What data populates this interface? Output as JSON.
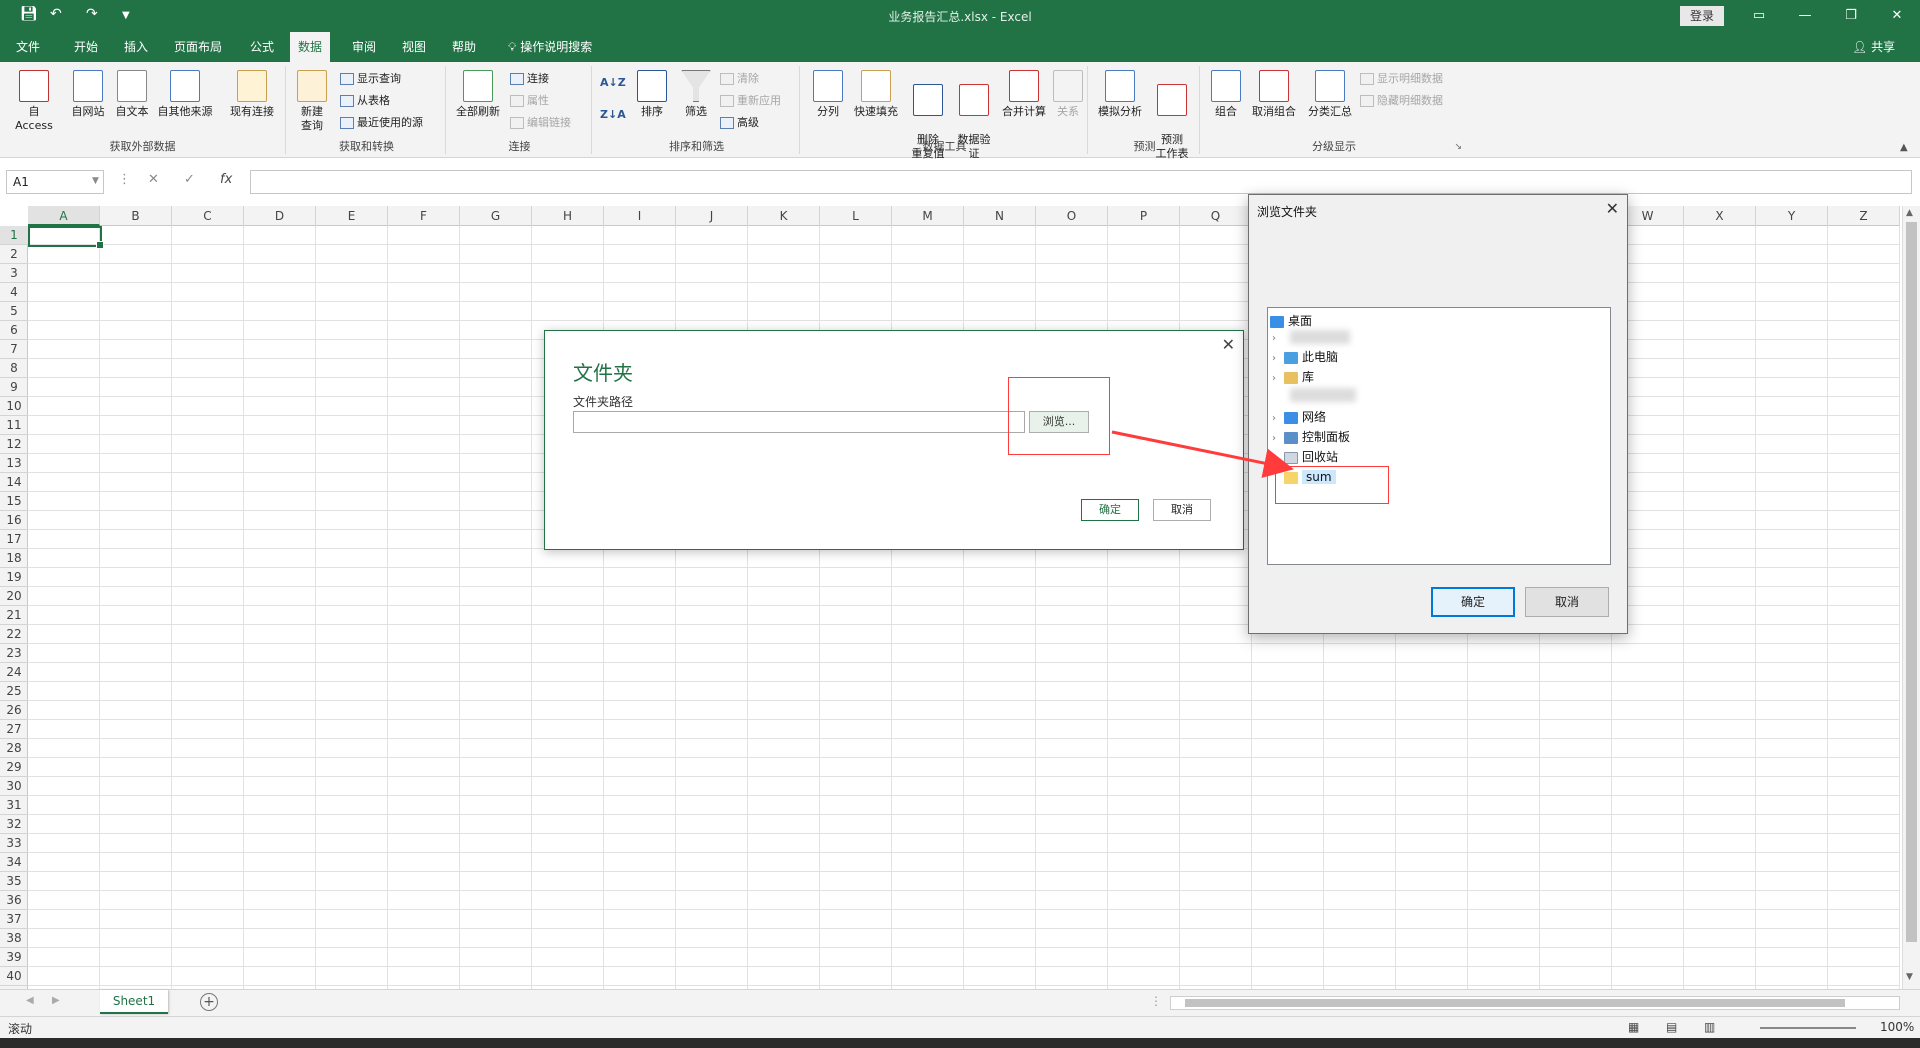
{
  "window": {
    "title": "业务报告汇总.xlsx  -  Excel",
    "login_label": "登录",
    "share_label": "共享"
  },
  "tabs": [
    "文件",
    "开始",
    "插入",
    "页面布局",
    "公式",
    "数据",
    "审阅",
    "视图",
    "帮助",
    "操作说明搜索"
  ],
  "active_tab": "数据",
  "ribbon": {
    "get_external": {
      "label": "获取外部数据",
      "buttons": [
        "自 Access",
        "自网站",
        "自文本",
        "自其他来源",
        "现有连接"
      ]
    },
    "get_transform": {
      "label": "获取和转换",
      "new_query_1": "新建",
      "new_query_2": "查询",
      "small": [
        "显示查询",
        "从表格",
        "最近使用的源"
      ]
    },
    "connections": {
      "label": "连接",
      "refresh_all": "全部刷新",
      "small": [
        "连接",
        "属性",
        "编辑链接"
      ]
    },
    "sort_filter": {
      "label": "排序和筛选",
      "sort": "排序",
      "filter": "筛选",
      "small": [
        "清除",
        "重新应用",
        "高级"
      ]
    },
    "data_tools": {
      "label": "数据工具",
      "buttons": [
        "分列",
        "快速填充",
        "删除\n重复值",
        "数据验\n证",
        "合并计算",
        "关系"
      ]
    },
    "forecast": {
      "label": "预测",
      "buttons": [
        "模拟分析",
        "预测\n工作表"
      ]
    },
    "outline": {
      "label": "分级显示",
      "buttons": [
        "组合",
        "取消组合",
        "分类汇总"
      ],
      "small": [
        "显示明细数据",
        "隐藏明细数据"
      ]
    }
  },
  "formula_bar": {
    "name_box": "A1",
    "cancel_icon": "✕",
    "enter_icon": "✓",
    "fx_label": "fx",
    "value": ""
  },
  "columns": [
    "A",
    "B",
    "C",
    "D",
    "E",
    "F",
    "G",
    "H",
    "I",
    "J",
    "K",
    "L",
    "M",
    "N",
    "O",
    "P",
    "Q",
    "R",
    "S",
    "T",
    "U",
    "V",
    "W",
    "X",
    "Y",
    "Z"
  ],
  "rows": [
    "1",
    "2",
    "3",
    "4",
    "5",
    "6",
    "7",
    "8",
    "9",
    "10",
    "11",
    "12",
    "13",
    "14",
    "15",
    "16",
    "17",
    "18",
    "19",
    "20",
    "21",
    "22",
    "23",
    "24",
    "25",
    "26",
    "27",
    "28",
    "29",
    "30",
    "31",
    "32",
    "33",
    "34",
    "35",
    "36",
    "37",
    "38",
    "39",
    "40"
  ],
  "sheet_tab": "Sheet1",
  "status": {
    "text": "滚动",
    "zoom": "100%"
  },
  "folder_dialog": {
    "title": "文件夹",
    "path_label": "文件夹路径",
    "path_value": "",
    "browse_label": "浏览...",
    "ok_label": "确定",
    "cancel_label": "取消"
  },
  "browse_dialog": {
    "title": "浏览文件夹",
    "nodes": [
      {
        "label": "桌面",
        "icon": "desktop-icon"
      },
      {
        "label": "此电脑",
        "icon": "computer-icon"
      },
      {
        "label": "库",
        "icon": "library-icon"
      },
      {
        "label": "网络",
        "icon": "network-icon"
      },
      {
        "label": "控制面板",
        "icon": "control-panel-icon"
      },
      {
        "label": "回收站",
        "icon": "recycle-bin-icon"
      },
      {
        "label": "sum",
        "icon": "folder-icon"
      }
    ],
    "ok_label": "确定",
    "cancel_label": "取消"
  },
  "colors": {
    "excel_green": "#217346",
    "annotation_red": "#ff3b3b",
    "selection_blue": "#cce8ff"
  }
}
